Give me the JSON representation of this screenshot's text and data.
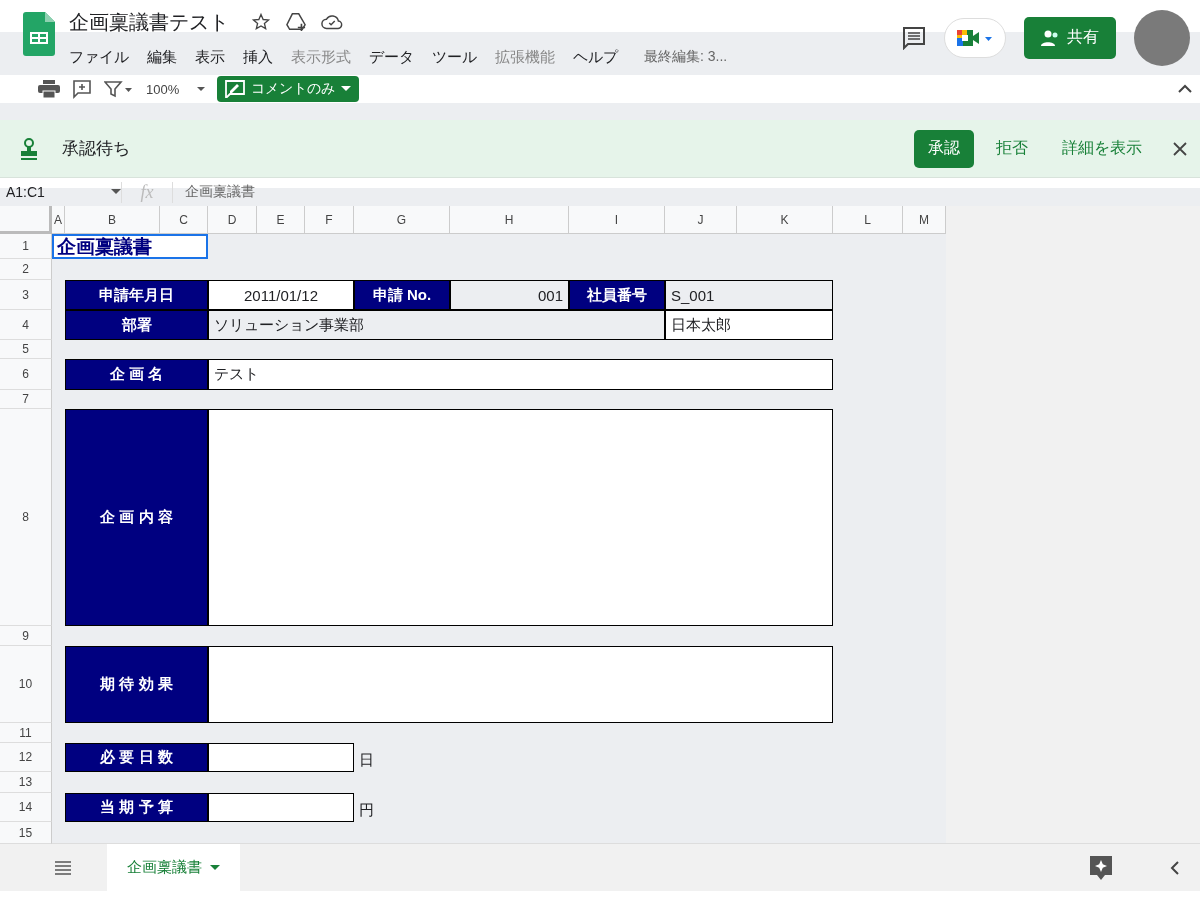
{
  "document": {
    "title": "企画稟議書テスト",
    "last_edit": "最終編集: 3..."
  },
  "menu": [
    {
      "label": "ファイル",
      "disabled": false
    },
    {
      "label": "編集",
      "disabled": false
    },
    {
      "label": "表示",
      "disabled": false
    },
    {
      "label": "挿入",
      "disabled": false
    },
    {
      "label": "表示形式",
      "disabled": true
    },
    {
      "label": "データ",
      "disabled": false
    },
    {
      "label": "ツール",
      "disabled": false
    },
    {
      "label": "拡張機能",
      "disabled": true
    },
    {
      "label": "ヘルプ",
      "disabled": false
    }
  ],
  "share_button": "共有",
  "toolbar": {
    "zoom": "100%",
    "mode": "コメントのみ"
  },
  "approval_banner": {
    "status": "承認待ち",
    "approve": "承認",
    "reject": "拒否",
    "details": "詳細を表示"
  },
  "formula_bar": {
    "name_box": "A1:C1",
    "fx": "fx",
    "content": "企画稟議書"
  },
  "columns": [
    "A",
    "B",
    "C",
    "D",
    "E",
    "F",
    "G",
    "H",
    "I",
    "J",
    "K",
    "L",
    "M"
  ],
  "rows": [
    "1",
    "2",
    "3",
    "4",
    "5",
    "6",
    "7",
    "8",
    "9",
    "10",
    "11",
    "12",
    "13",
    "14",
    "15"
  ],
  "cells": [
    {
      "kind": "title",
      "text": "企画稟議書",
      "selected": true
    },
    {
      "kind": "label",
      "text": "申請年月日"
    },
    {
      "kind": "value",
      "text": "2011/01/12"
    },
    {
      "kind": "label",
      "text": "申請 No."
    },
    {
      "kind": "value",
      "text": "001",
      "shaded": true
    },
    {
      "kind": "label",
      "text": "社員番号"
    },
    {
      "kind": "value",
      "text": "S_001",
      "shaded": true
    },
    {
      "kind": "label",
      "text": "部署"
    },
    {
      "kind": "value",
      "text": "ソリューション事業部",
      "shaded": true
    },
    {
      "kind": "value",
      "text": "日本太郎"
    },
    {
      "kind": "label",
      "text": "企 画 名"
    },
    {
      "kind": "value",
      "text": "テスト"
    },
    {
      "kind": "label",
      "text": "企 画 内 容"
    },
    {
      "kind": "value"
    },
    {
      "kind": "label",
      "text": "期 待 効 果"
    },
    {
      "kind": "value"
    },
    {
      "kind": "label",
      "text": "必 要 日 数"
    },
    {
      "kind": "value"
    },
    {
      "kind": "unit",
      "text": "日"
    },
    {
      "kind": "label",
      "text": "当 期 予 算"
    },
    {
      "kind": "value"
    },
    {
      "kind": "unit",
      "text": "円"
    }
  ],
  "sheet_tabs": [
    {
      "label": "企画稟議書",
      "selected": true
    }
  ]
}
